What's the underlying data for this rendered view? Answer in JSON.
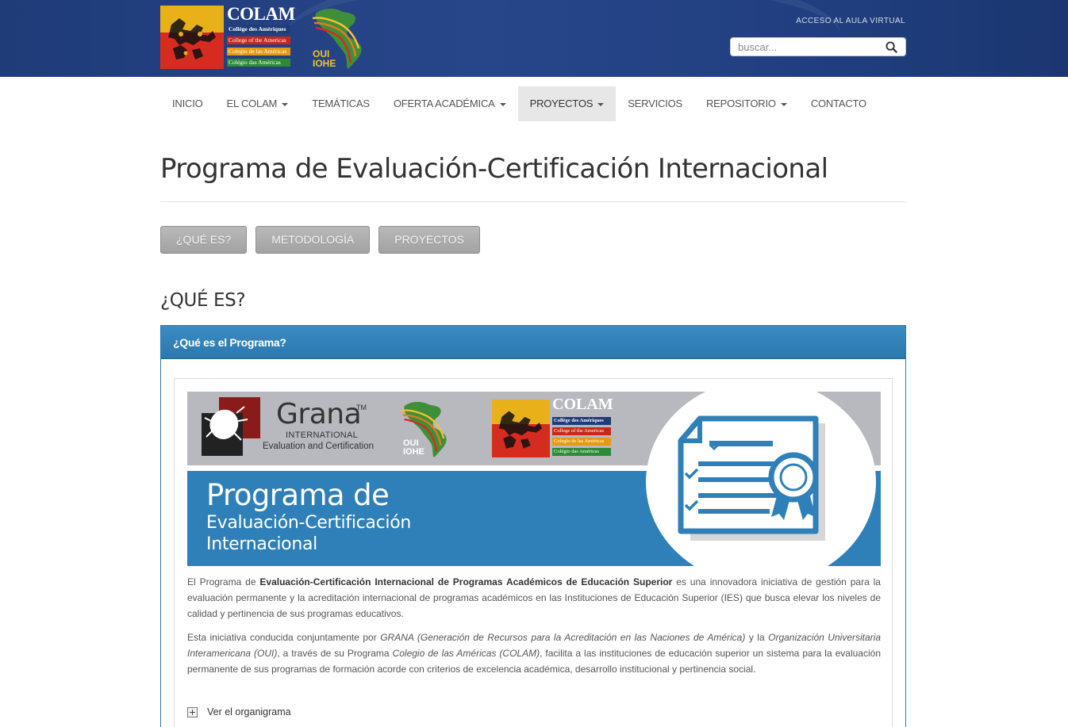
{
  "header": {
    "logo": {
      "name": "COLAM",
      "lines": [
        "Collège des Amériques",
        "College of the Americas",
        "Colegio de las Américas",
        "Colégio das Américas"
      ]
    },
    "oui_logo": {
      "line1": "OUI",
      "line2": "IOHE"
    },
    "aula_link": "ACCESO AL AULA VIRTUAL",
    "search": {
      "placeholder": "buscar..."
    }
  },
  "nav": {
    "items": [
      {
        "label": "INICIO",
        "dropdown": false,
        "active": false
      },
      {
        "label": "EL COLAM",
        "dropdown": true,
        "active": false
      },
      {
        "label": "TEMÁTICAS",
        "dropdown": false,
        "active": false
      },
      {
        "label": "OFERTA ACADÉMICA",
        "dropdown": true,
        "active": false
      },
      {
        "label": "PROYECTOS",
        "dropdown": true,
        "active": true
      },
      {
        "label": "SERVICIOS",
        "dropdown": false,
        "active": false
      },
      {
        "label": "REPOSITORIO",
        "dropdown": true,
        "active": false
      },
      {
        "label": "CONTACTO",
        "dropdown": false,
        "active": false
      }
    ]
  },
  "page": {
    "title": "Programa de Evaluación-Certificación Internacional",
    "tab_buttons": [
      "¿QUÉ ES?",
      "METODOLOGÍA",
      "PROYECTOS"
    ],
    "section_heading": "¿QUÉ ES?"
  },
  "panel": {
    "heading": "¿Qué es el Programa?",
    "banner": {
      "grana_word": "Grana",
      "grana_tm": "TM",
      "grana_international": "INTERNATIONAL",
      "grana_eval": "Evaluation and Certification",
      "oui_line1": "OUI",
      "oui_line2": "IOHE",
      "colam_name": "COLAM",
      "colam_lines": [
        "Collège des Amériques",
        "College of the Americas",
        "Colegio de las Américas",
        "Colégio das Américas"
      ],
      "title_line1": "Programa de",
      "title_line2": "Evaluación-Certificación",
      "title_line3": "Internacional"
    },
    "paragraph1": {
      "pre": "El Programa de ",
      "bold": "Evaluación-Certificación Internacional de Programas Académicos de Educación Superior",
      "post": " es una innovadora iniciativa de gestión para la evaluación permanente y la acreditación internacional de programas académicos en las Instituciones de Educación Superior (IES) que busca elevar los niveles de calidad y pertinencia de sus programas educativos."
    },
    "paragraph2": {
      "t1": "Esta iniciativa conducida conjuntamente por ",
      "i1": "GRANA (Generación de Recursos para la Acreditación en las Naciones de América)",
      "t2": " y la ",
      "i2": "Organización Universitaria Interamericana (OUI)",
      "t3": ", a través de su Programa ",
      "i3": "Colegio de las Américas (COLAM)",
      "t4": ", facilita a las instituciones de educación superior un sistema para la evaluación permanente de sus programas de formación acorde con criterios de excelencia académica, desarrollo institucional y pertinencia social."
    },
    "organigrama_label": "Ver el organigrama"
  },
  "colors": {
    "header_bg": "#27468a",
    "panel_heading": "#2f80b8",
    "nav_active_bg": "#e7e7e7",
    "tab_button_bg": "#aaaaaa"
  }
}
